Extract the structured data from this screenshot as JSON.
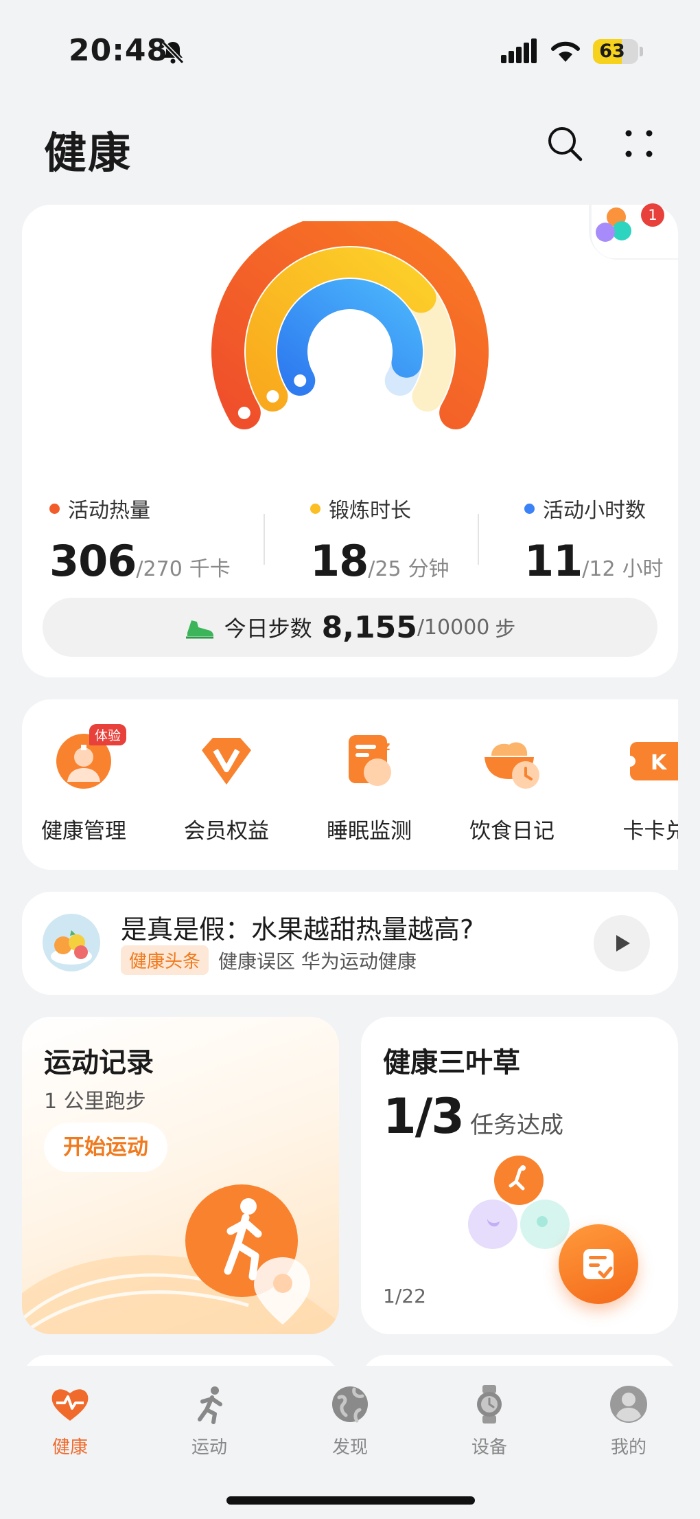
{
  "status_bar": {
    "time": "20:48",
    "battery": "63",
    "battery_level": 0.63
  },
  "header": {
    "title": "健康"
  },
  "activity": {
    "badge_count": "1",
    "colors": {
      "calories": "#f25c2a",
      "exercise": "#fbbf24",
      "hours": "#3b82f6"
    },
    "progress": {
      "calories": 1.13,
      "exercise": 0.72,
      "hours": 0.92
    },
    "metrics": [
      {
        "label": "活动热量",
        "value": "306",
        "target": "/270",
        "unit": "千卡"
      },
      {
        "label": "锻炼时长",
        "value": "18",
        "target": "/25",
        "unit": "分钟"
      },
      {
        "label": "活动小时数",
        "value": "11",
        "target": "/12",
        "unit": "小时"
      }
    ],
    "steps": {
      "label": "今日步数",
      "value": "8,155",
      "goal": "/10000",
      "unit": "步"
    }
  },
  "services": [
    {
      "label": "健康管理",
      "tag": "体验",
      "icon": "doctor-icon"
    },
    {
      "label": "会员权益",
      "icon": "vip-icon"
    },
    {
      "label": "睡眠监测",
      "icon": "sleep-icon"
    },
    {
      "label": "饮食日记",
      "icon": "food-icon"
    },
    {
      "label": "卡卡兑",
      "icon": "card-icon"
    }
  ],
  "news": {
    "title": "是真是假：水果越甜热量越高?",
    "tag": "健康头条",
    "meta": "健康误区 华为运动健康"
  },
  "exercise": {
    "title": "运动记录",
    "subtitle": "1 公里跑步",
    "button": "开始运动"
  },
  "clover": {
    "title": "健康三叶草",
    "progress": "1/3",
    "progress_label": "任务达成",
    "date": "1/22"
  },
  "nav": [
    {
      "label": "健康",
      "icon": "heart-pulse-icon",
      "active": true
    },
    {
      "label": "运动",
      "icon": "runner-icon"
    },
    {
      "label": "发现",
      "icon": "globe-icon"
    },
    {
      "label": "设备",
      "icon": "watch-icon"
    },
    {
      "label": "我的",
      "icon": "profile-icon"
    }
  ]
}
